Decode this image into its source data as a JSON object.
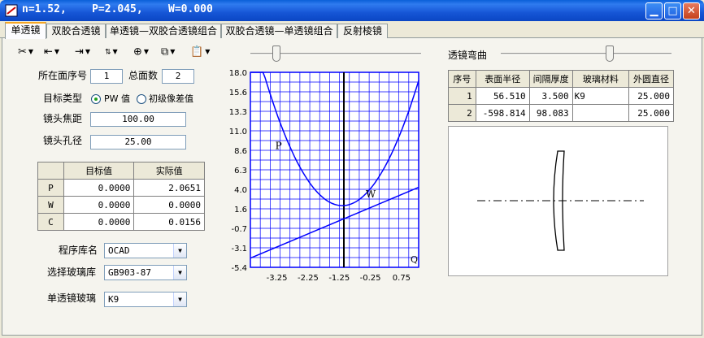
{
  "window": {
    "title": "n=1.52,    P=2.045,    W=0.000"
  },
  "tabs": [
    {
      "label": "单透镜",
      "active": true
    },
    {
      "label": "双胶合透镜",
      "active": false
    },
    {
      "label": "单透镜—双胶合透镜组合",
      "active": false
    },
    {
      "label": "双胶合透镜—单透镜组合",
      "active": false
    },
    {
      "label": "反射棱镜",
      "active": false
    }
  ],
  "toolbar": {
    "icons": [
      "scissors-icon",
      "align-left-icon",
      "align-right-icon",
      "sort-icon",
      "zoom-icon",
      "copy-icon",
      "paste-icon"
    ]
  },
  "surface": {
    "index_label": "所在面序号",
    "index_value": "1",
    "total_label": "总面数",
    "total_value": "2"
  },
  "target_type": {
    "label": "目标类型",
    "option_pw": "PW 值",
    "option_primary": "初级像差值",
    "selected": "pw"
  },
  "focal": {
    "label": "镜头焦距",
    "value": "100.00"
  },
  "aperture": {
    "label": "镜头孔径",
    "value": "25.00"
  },
  "results_table": {
    "headers": [
      "",
      "目标值",
      "实际值"
    ],
    "rows": [
      {
        "name": "P",
        "target": "0.0000",
        "actual": "2.0651"
      },
      {
        "name": "W",
        "target": "0.0000",
        "actual": "0.0000"
      },
      {
        "name": "C",
        "target": "0.0000",
        "actual": "0.0156"
      }
    ]
  },
  "library": {
    "label": "程序库名",
    "value": "OCAD"
  },
  "glass_lib": {
    "label": "选择玻璃库",
    "value": "GB903-87"
  },
  "lens_glass": {
    "label": "单透镜玻璃",
    "value": "K9"
  },
  "bend": {
    "label": "透镜弯曲"
  },
  "surface_table": {
    "headers": [
      "序号",
      "表面半径",
      "间隔厚度",
      "玻璃材料",
      "外圆直径"
    ],
    "rows": [
      {
        "no": "1",
        "radius": "56.510",
        "thickness": "3.500",
        "glass": "K9",
        "diameter": "25.000"
      },
      {
        "no": "2",
        "radius": "-598.814",
        "thickness": "98.083",
        "glass": "",
        "diameter": "25.000"
      }
    ]
  },
  "chart_data": {
    "type": "line",
    "ylim": [
      -5.4,
      18.0
    ],
    "xlim": [
      -4.1,
      1.3
    ],
    "yticks": [
      "18.0",
      "15.6",
      "13.3",
      "11.0",
      "8.6",
      "6.3",
      "4.0",
      "1.6",
      "-0.7",
      "-3.1",
      "-5.4"
    ],
    "xticks": [
      "-3.25",
      "-2.25",
      "-1.25",
      "-0.25",
      "0.75"
    ],
    "xtick_values": [
      -3.25,
      -2.25,
      -1.25,
      -0.25,
      0.75
    ],
    "vertical_marker_x": -1.1,
    "series": [
      {
        "name": "P",
        "type": "quadratic",
        "vertex_x": -1.15,
        "vertex_y": 2.0,
        "curvature": 2.5
      },
      {
        "name": "W",
        "type": "linear",
        "x": [
          -4.1,
          1.3
        ],
        "y": [
          -4.3,
          4.2
        ]
      }
    ],
    "corner_label": "Q",
    "colors": {
      "grid": "#0000ff",
      "curve": "#0000ff",
      "marker": "#000000"
    }
  }
}
